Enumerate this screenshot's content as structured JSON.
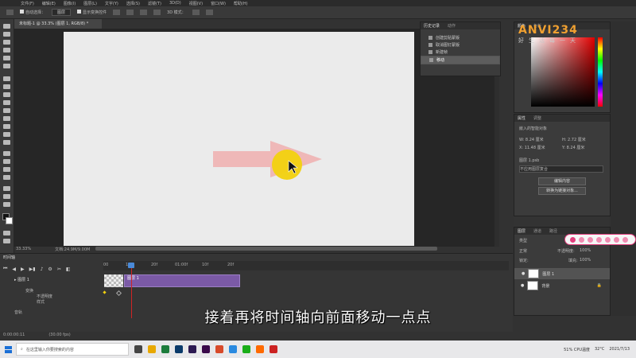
{
  "menubar": [
    "文件(F)",
    "编辑(E)",
    "图像(I)",
    "图层(L)",
    "文字(Y)",
    "选择(S)",
    "滤镜(T)",
    "3D(D)",
    "视图(V)",
    "窗口(W)",
    "帮助(H)"
  ],
  "options": {
    "auto_select": "自动选择：",
    "layer_select": "图层",
    "show_transform": "显示变换控件",
    "mode_3d": "3D 模式："
  },
  "document": {
    "tab_title": "未标题-1 @ 33.3% (图层 1, RGB/8) *",
    "zoom": "33.33%",
    "doc_info": "文档:24.9M/9.00M"
  },
  "history": {
    "tabs": [
      "历史记录",
      "动作"
    ],
    "items": [
      "创建剪贴蒙版",
      "取消图钉蒙版",
      "新建帧",
      "移动"
    ]
  },
  "color": {
    "tabs": [
      "颜色",
      "色板"
    ]
  },
  "properties": {
    "tabs": [
      "属性",
      "调整"
    ],
    "type_label": "嵌入的智能对象",
    "w": "W: 8.24 厘米",
    "h": "H: 2.72 厘米",
    "x": "X: 11.48 厘米",
    "y": "Y: 8.24 厘米",
    "filename": "图层 1.psb",
    "comp": "不应用图层复合",
    "edit_btn": "编辑内容",
    "convert_btn": "转换为链接对象..."
  },
  "layers": {
    "tabs": [
      "图层",
      "通道",
      "路径"
    ],
    "kind": "类型",
    "blend": "正常",
    "opacity_label": "不透明度:",
    "opacity": "100%",
    "lock_label": "锁定:",
    "fill_label": "填充:",
    "fill": "100%",
    "items": [
      {
        "name": "图层 1",
        "selected": true
      },
      {
        "name": "背景",
        "selected": false
      }
    ]
  },
  "logo": {
    "brand": "ANVI234",
    "tagline": "好生活每一天"
  },
  "timeline": {
    "title": "时间轴",
    "ruler": [
      "00",
      "10f",
      "20f",
      "01:00f",
      "10f",
      "20f"
    ],
    "layer_name": "图层 1",
    "clip_name": "图层 1",
    "props": [
      "变换",
      "不透明度",
      "样式"
    ],
    "audio": "音轨",
    "timecode": "0:00:00:11",
    "fps": "(30.00 fps)"
  },
  "subtitle": "接着再将时间轴向前面移动一点点",
  "taskbar": {
    "search_placeholder": "在这里输入你要搜索的内容",
    "weather": "32°C",
    "cpu": "51% CPU温度",
    "date": "2021/7/13"
  },
  "colors": {
    "accent_pink": "#e23e7d",
    "clip_purple": "#7b5aa6",
    "arrow_pink": "#efb8b8",
    "highlight": "#f2d10e"
  }
}
